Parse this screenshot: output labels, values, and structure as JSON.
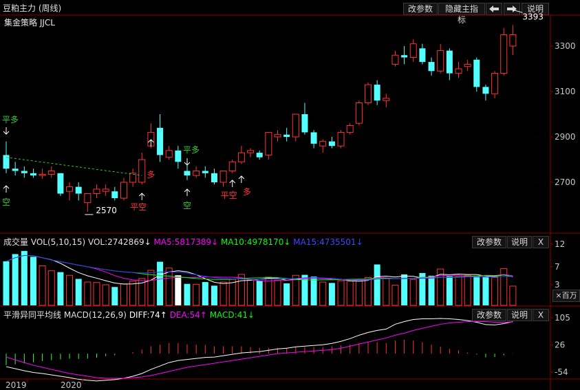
{
  "header": {
    "title": "豆粕主力 (周线)",
    "buttons": {
      "params": "改参数",
      "hide_indicator": "隐藏主指标",
      "left_arrow": "🡄",
      "right_arrow": "🡆",
      "help": "说明"
    }
  },
  "main_panel": {
    "strategy_label": "集金策略 JJCL",
    "price_axis": [
      "3300",
      "3100",
      "2900",
      "2700"
    ],
    "high_label": "3393",
    "low_label": "2570",
    "signals": {
      "flat_long_1": "平多",
      "short_1": "空",
      "long_1": "多",
      "flat_short_1": "平空",
      "flat_long_2": "平多",
      "short_2": "空",
      "flat_short_2": "平空",
      "long_2": "多"
    }
  },
  "volume_panel": {
    "title": "成交量",
    "vol": "VOL(5,10,15)",
    "vol_value": "VOL:2742869↓",
    "ma5": "MA5:5817389↓",
    "ma10": "MA10:4978170↓",
    "ma15": "MA15:4735501↓",
    "axis": [
      "12",
      "7",
      "3"
    ],
    "unit": "×百万",
    "buttons": {
      "params": "改参数",
      "help": "说明",
      "close": "X"
    }
  },
  "macd_panel": {
    "title": "平滑异同平均线",
    "macd": "MACD(12,26,9)",
    "diff": "DIFF:74↑",
    "dea": "DEA:54↑",
    "macd_value": "MACD:41↓",
    "axis": [
      "105",
      "26",
      "-54"
    ],
    "buttons": {
      "params": "改参数",
      "help": "说明",
      "close": "X"
    }
  },
  "time_axis": [
    "2019",
    "2020"
  ],
  "colors": {
    "up": "#ff3232",
    "down": "#54ffff",
    "ma5": "#ffffff",
    "ma10": "#ff00ff",
    "ma15": "#00ff00",
    "ma_vol15": "#3333ff",
    "grid": "#8b0000",
    "signal_green": "#33cc33",
    "signal_red": "#ff3333"
  },
  "chart_data": {
    "type": "candlestick",
    "candles": [
      [
        2820,
        2760,
        2880,
        2740
      ],
      [
        2760,
        2750,
        2790,
        2730
      ],
      [
        2750,
        2740,
        2770,
        2720
      ],
      [
        2740,
        2730,
        2760,
        2720
      ],
      [
        2730,
        2735,
        2760,
        2715
      ],
      [
        2735,
        2750,
        2770,
        2720
      ],
      [
        2740,
        2650,
        2740,
        2640
      ],
      [
        2660,
        2680,
        2700,
        2620
      ],
      [
        2680,
        2650,
        2700,
        2620
      ],
      [
        2610,
        2650,
        2650,
        2570
      ],
      [
        2650,
        2670,
        2690,
        2630
      ],
      [
        2660,
        2670,
        2690,
        2640
      ],
      [
        2660,
        2630,
        2680,
        2620
      ],
      [
        2630,
        2700,
        2720,
        2620
      ],
      [
        2700,
        2740,
        2760,
        2680
      ],
      [
        2700,
        2800,
        2830,
        2690
      ],
      [
        2860,
        2920,
        2960,
        2850
      ],
      [
        2940,
        2820,
        3000,
        2790
      ],
      [
        2810,
        2840,
        2860,
        2800
      ],
      [
        2840,
        2790,
        2860,
        2760
      ],
      [
        2750,
        2730,
        2780,
        2710
      ],
      [
        2730,
        2750,
        2770,
        2720
      ],
      [
        2750,
        2740,
        2770,
        2720
      ],
      [
        2740,
        2700,
        2760,
        2690
      ],
      [
        2700,
        2750,
        2750,
        2680
      ],
      [
        2750,
        2790,
        2800,
        2740
      ],
      [
        2790,
        2830,
        2860,
        2780
      ],
      [
        2830,
        2840,
        2850,
        2810
      ],
      [
        2830,
        2810,
        2840,
        2800
      ],
      [
        2820,
        2920,
        2920,
        2800
      ],
      [
        2900,
        2910,
        2930,
        2880
      ],
      [
        2910,
        2900,
        2940,
        2880
      ],
      [
        2900,
        3000,
        3000,
        2880
      ],
      [
        3000,
        2920,
        3050,
        2910
      ],
      [
        2920,
        2870,
        2930,
        2850
      ],
      [
        2860,
        2880,
        2890,
        2830
      ],
      [
        2880,
        2860,
        2900,
        2850
      ],
      [
        2860,
        2920,
        2930,
        2850
      ],
      [
        2920,
        2950,
        2960,
        2910
      ],
      [
        2960,
        3050,
        3060,
        2950
      ],
      [
        3050,
        3130,
        3140,
        3040
      ],
      [
        3130,
        3060,
        3150,
        3040
      ],
      [
        3060,
        3070,
        3090,
        3030
      ],
      [
        3220,
        3260,
        3280,
        3210
      ],
      [
        3260,
        3250,
        3300,
        3220
      ],
      [
        3250,
        3310,
        3330,
        3230
      ],
      [
        3290,
        3230,
        3310,
        3220
      ],
      [
        3230,
        3190,
        3250,
        3170
      ],
      [
        3190,
        3280,
        3310,
        3180
      ],
      [
        3280,
        3180,
        3290,
        3150
      ],
      [
        3180,
        3200,
        3230,
        3160
      ],
      [
        3210,
        3220,
        3240,
        3190
      ],
      [
        3240,
        3120,
        3250,
        3100
      ],
      [
        3120,
        3090,
        3130,
        3060
      ],
      [
        3090,
        3180,
        3190,
        3070
      ],
      [
        3180,
        3350,
        3380,
        3170
      ],
      [
        3300,
        3350,
        3393,
        3260
      ]
    ],
    "volume_millions": [
      8.2,
      9.8,
      10.5,
      9.2,
      7.2,
      6.1,
      5.8,
      5.1,
      4.3,
      3.6,
      3.5,
      3.0,
      2.5,
      3.2,
      3.8,
      4.4,
      6.2,
      8.1,
      6.7,
      5.1,
      3.2,
      3.1,
      3.6,
      2.8,
      3.6,
      4.2,
      5.3,
      4.1,
      3.9,
      4.7,
      4.0,
      3.3,
      5.1,
      5.2,
      4.8,
      3.6,
      3.4,
      3.9,
      3.8,
      4.2,
      4.6,
      7.5,
      4.4,
      2.9,
      5.3,
      4.2,
      5.6,
      5.0,
      6.5,
      4.9,
      4.8,
      5.1,
      5.0,
      4.8,
      4.6,
      6.6,
      2.7
    ],
    "macd_diff": [
      -38,
      -44,
      -50,
      -55,
      -58,
      -62,
      -66,
      -70,
      -75,
      -78,
      -80,
      -78,
      -76,
      -72,
      -66,
      -58,
      -46,
      -36,
      -26,
      -20,
      -17,
      -14,
      -11,
      -10,
      -6,
      -2,
      2,
      4,
      6,
      10,
      14,
      16,
      20,
      22,
      24,
      26,
      30,
      36,
      44,
      54,
      62,
      68,
      72,
      86,
      94,
      100,
      102,
      102,
      103,
      102,
      100,
      97,
      92,
      85,
      84,
      88,
      94
    ],
    "macd_dea": [
      -10,
      -18,
      -26,
      -34,
      -40,
      -46,
      -52,
      -58,
      -62,
      -66,
      -70,
      -72,
      -72,
      -72,
      -70,
      -68,
      -64,
      -58,
      -52,
      -46,
      -40,
      -36,
      -32,
      -28,
      -24,
      -20,
      -16,
      -12,
      -8,
      -4,
      0,
      2,
      4,
      6,
      8,
      10,
      12,
      16,
      22,
      28,
      34,
      40,
      46,
      54,
      60,
      68,
      74,
      80,
      86,
      90,
      92,
      94,
      94,
      94,
      92,
      92,
      93
    ],
    "macd_hist": [
      -56,
      -52,
      -48,
      -42,
      -36,
      -32,
      -28,
      -24,
      -26,
      -24,
      -20,
      -12,
      -8,
      0,
      8,
      20,
      36,
      44,
      52,
      52,
      46,
      44,
      42,
      36,
      36,
      36,
      36,
      32,
      28,
      28,
      28,
      28,
      32,
      32,
      32,
      32,
      36,
      40,
      44,
      52,
      56,
      56,
      52,
      64,
      68,
      64,
      56,
      44,
      34,
      24,
      16,
      6,
      -4,
      -18,
      -16,
      -8,
      2
    ]
  }
}
